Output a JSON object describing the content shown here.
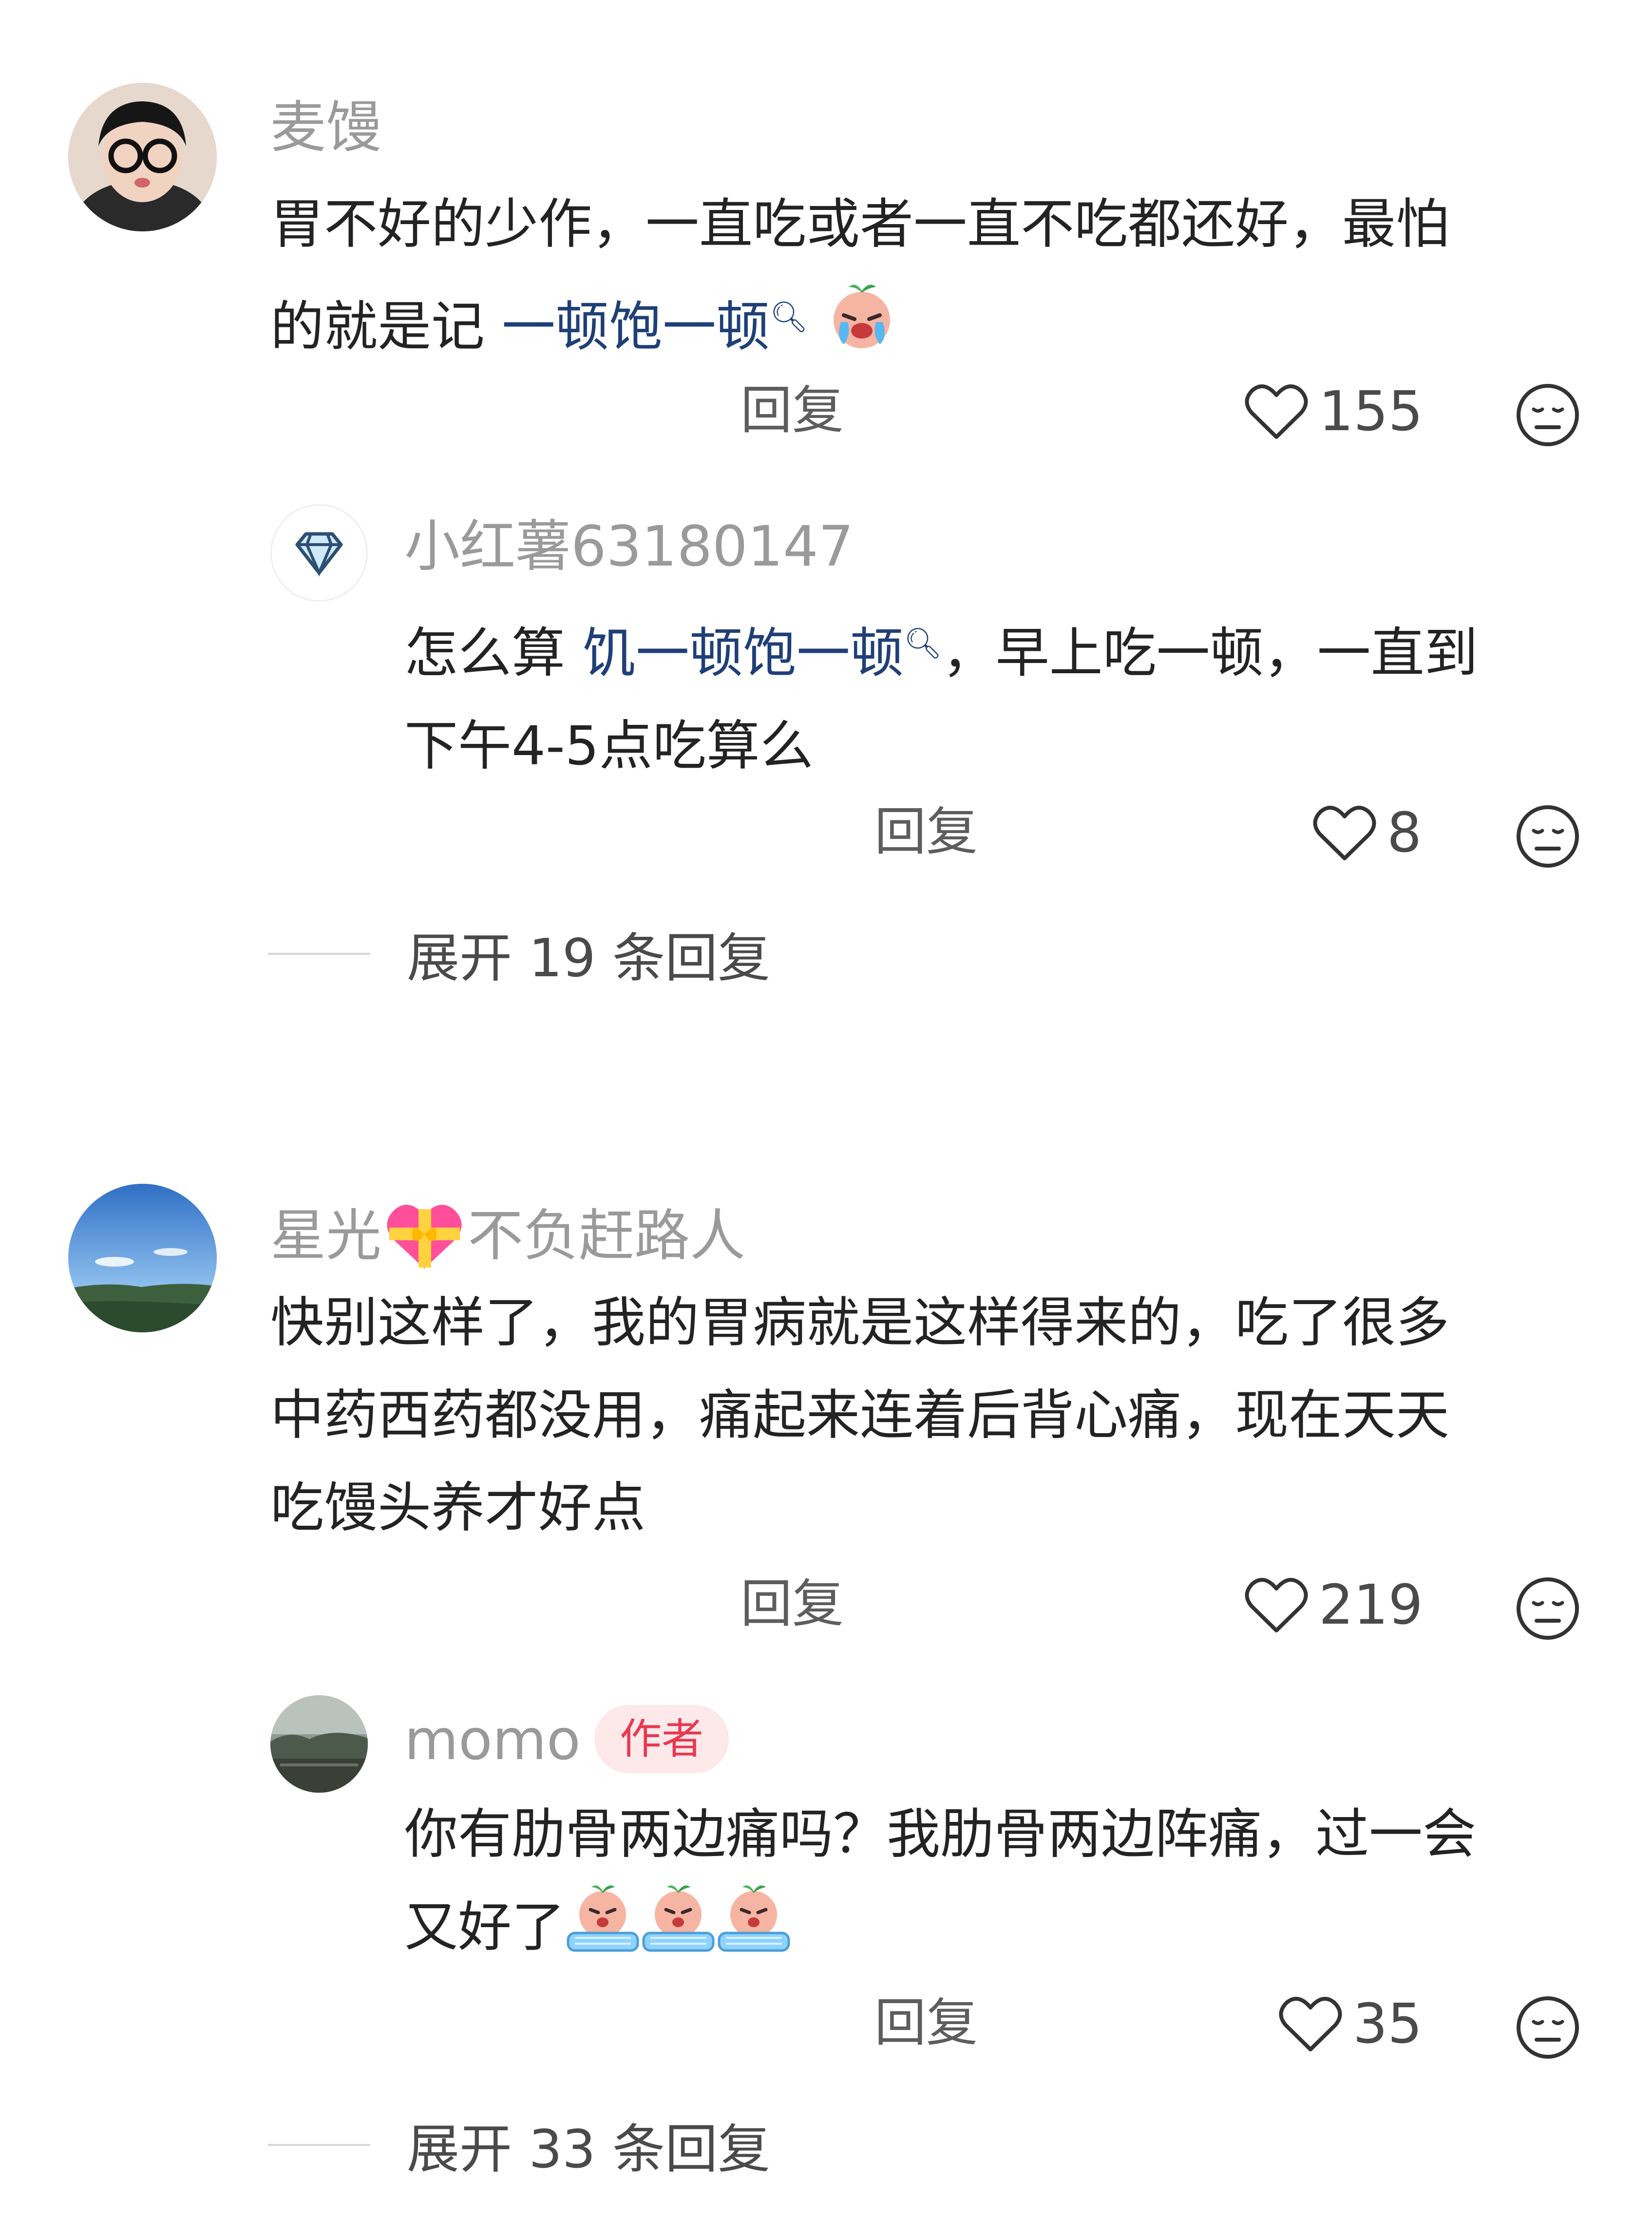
{
  "comments": [
    {
      "username": "麦馒",
      "text_line1": "胃不好的少作，一直吃或者一直不吃都还好，最怕",
      "text_line2_prefix": "的就是记 ",
      "text_line2_link": "一顿饱一顿",
      "reply_label": "回复",
      "likes": "155",
      "reply": {
        "username": "小红薯63180147",
        "text_line1_prefix": "怎么算 ",
        "text_line1_link": "饥一顿饱一顿",
        "text_line1_suffix": "，早上吃一顿，一直到",
        "text_line2": "下午4-5点吃算么",
        "reply_label": "回复",
        "likes": "8"
      },
      "expand_label": "展开 19 条回复"
    },
    {
      "username_part1": "星光",
      "username_part2": "不负赶路人",
      "text_line1": "快别这样了，我的胃病就是这样得来的，吃了很多",
      "text_line2": "中药西药都没用，痛起来连着后背心痛，现在天天",
      "text_line3": "吃馒头养才好点",
      "reply_label": "回复",
      "likes": "219",
      "reply": {
        "username": "momo",
        "badge": "作者",
        "text_line1": "你有肋骨两边痛吗？我肋骨两边阵痛，过一会",
        "text_line2": "又好了",
        "reply_label": "回复",
        "likes": "35"
      },
      "expand_label": "展开 33 条回复"
    }
  ],
  "icons": {
    "like": "heart-outline-icon",
    "more": "neutral-face-icon",
    "search": "search-icon"
  },
  "colors": {
    "link": "#1f3f77",
    "badge_text": "#e8384f",
    "badge_bg": "#fde8ea"
  }
}
